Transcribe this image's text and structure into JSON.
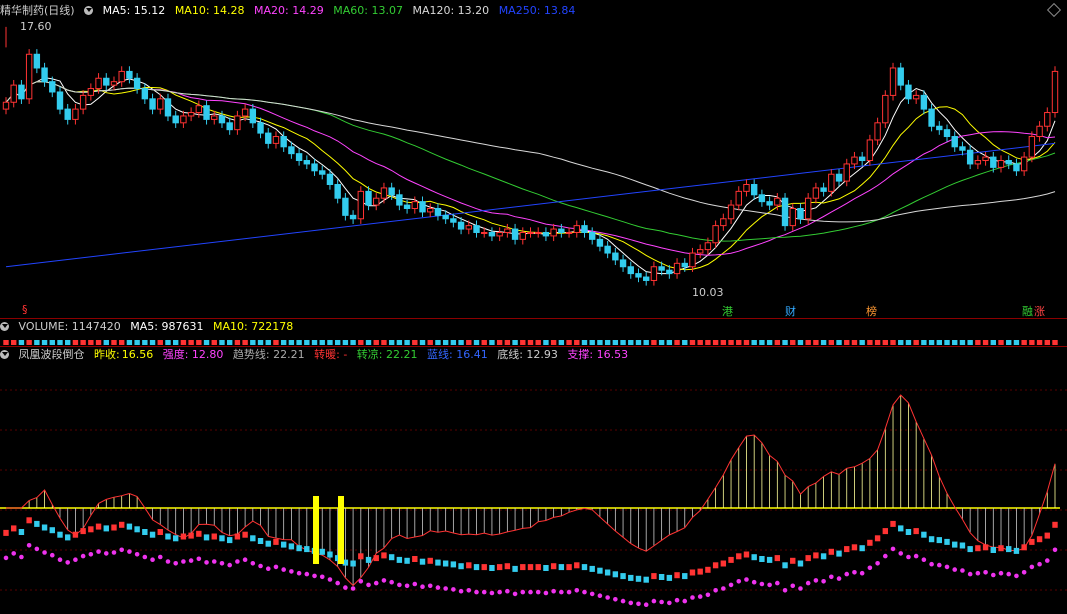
{
  "main_legend": {
    "title": "精华制药(日线)",
    "ma5": "MA5: 15.12",
    "ma10": "MA10: 14.28",
    "ma20": "MA20: 14.29",
    "ma60": "MA60: 13.07",
    "ma120": "MA120: 13.20",
    "ma250": "MA250: 13.84"
  },
  "volume_legend": {
    "title": "VOLUME: 1147420",
    "ma5": "MA5: 987631",
    "ma10": "MA10: 722178"
  },
  "indicator_legend": {
    "title": "凤凰波段倒仓",
    "prev_close_label": "昨收:",
    "prev_close": "16.56",
    "strength": "强度: 12.80",
    "trend": "趋势线: 22.21",
    "turn_warm": "转暖: -",
    "turn_strong": "转凉: 22.21",
    "blue_line": "蓝线: 16.41",
    "bottom_line": "底线: 12.93",
    "support": "支撑: 16.53"
  },
  "annotations": {
    "high_price": "17.60",
    "low_price": "10.03",
    "markers": [
      "§",
      "港",
      "财",
      "榜",
      "融",
      "涨"
    ]
  },
  "colors": {
    "up": "#ff3333",
    "down": "#33ccee",
    "ma5": "#ffffff",
    "ma10": "#ffff00",
    "ma20": "#ff44ff",
    "ma60": "#33cc33",
    "ma120": "#d8d8d8",
    "ma250": "#2244ff"
  },
  "chart_data": {
    "type": "candlestick",
    "closes": [
      15.4,
      15.9,
      15.5,
      16.8,
      16.4,
      16.0,
      15.7,
      15.2,
      14.9,
      15.2,
      15.6,
      15.8,
      16.1,
      15.9,
      16.0,
      16.3,
      16.1,
      15.8,
      15.5,
      15.2,
      15.5,
      15.0,
      14.8,
      15.0,
      15.1,
      15.3,
      14.9,
      15.0,
      14.8,
      14.6,
      15.0,
      15.2,
      14.8,
      14.5,
      14.2,
      14.4,
      14.1,
      13.9,
      13.7,
      13.6,
      13.4,
      13.3,
      13.0,
      12.6,
      12.1,
      12.0,
      12.8,
      12.4,
      12.6,
      12.9,
      12.7,
      12.4,
      12.3,
      12.5,
      12.2,
      12.3,
      12.1,
      12.0,
      11.9,
      11.7,
      11.8,
      11.6,
      11.6,
      11.5,
      11.6,
      11.7,
      11.4,
      11.6,
      11.6,
      11.6,
      11.5,
      11.7,
      11.6,
      11.6,
      11.8,
      11.6,
      11.4,
      11.2,
      11.0,
      10.8,
      10.6,
      10.4,
      10.3,
      10.2,
      10.6,
      10.5,
      10.4,
      10.7,
      10.6,
      11.0,
      11.1,
      11.3,
      11.8,
      12.0,
      12.4,
      12.8,
      13.0,
      12.7,
      12.5,
      12.4,
      12.6,
      11.8,
      12.3,
      12.0,
      12.6,
      12.9,
      12.8,
      13.3,
      13.1,
      13.6,
      13.8,
      13.7,
      14.3,
      14.8,
      15.6,
      16.4,
      15.9,
      15.5,
      15.6,
      15.2,
      14.7,
      14.6,
      14.4,
      14.1,
      14.0,
      13.6,
      13.7,
      13.8,
      13.5,
      13.7,
      13.6,
      13.4,
      13.8,
      14.4,
      14.7,
      15.1,
      16.3
    ],
    "highs_lows": {
      "max": 17.6,
      "min": 10.03
    },
    "volume": {
      "last": 1147420,
      "ma5": 987631,
      "ma10": 722178
    }
  }
}
